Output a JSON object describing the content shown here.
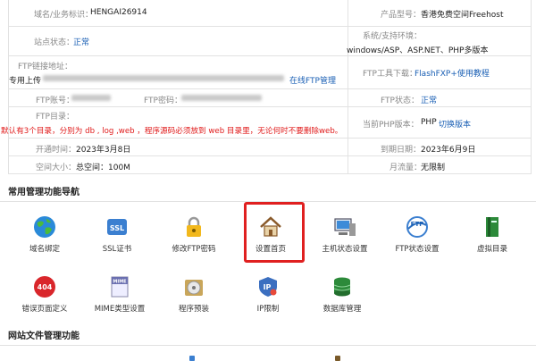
{
  "account": {
    "domain_label": "域名/业务标识：",
    "domain_value": "HENGAI26914",
    "product_label": "产品型号：",
    "product_value": "香港免费空间Freehost",
    "site_status_label": "站点状态：",
    "site_status_value": "正常",
    "env_label": "系统/支持环境：",
    "env_value": "windows/ASP、ASP.NET、PHP多版本",
    "ftp_addr_label": "FTP链接地址：",
    "ftp_addr_prefix": "专用上传",
    "ftp_online_link": "在线FTP管理",
    "ftp_tool_label": "FTP工具下载：",
    "ftp_tool_link": "FlashFXP+使用教程",
    "ftp_account_label": "FTP账号：",
    "ftp_password_label": "FTP密码：",
    "ftp_status_label": "FTP状态：",
    "ftp_status_value": "正常",
    "ftp_dir_label": "FTP目录：",
    "ftp_dir_warning": "默认有3个目录，分别为 db , log ,web ，程序源码必须放到 web 目录里，无论何时不要删除web。",
    "php_label": "当前PHP版本：",
    "php_value": "PHP",
    "php_switch": "切换版本",
    "open_label": "开通时间：",
    "open_value": "2023年3月8日",
    "expire_label": "到期日期：",
    "expire_value": "2023年6月9日",
    "space_label": "空间大小：",
    "space_value": "总空间：100M",
    "traffic_label": "月流量：",
    "traffic_value": "无限制"
  },
  "sections": {
    "common": "常用管理功能导航",
    "files": "网站文件管理功能"
  },
  "nav": [
    {
      "label": "域名绑定",
      "icon": "globe-icon"
    },
    {
      "label": "SSL证书",
      "icon": "ssl-icon"
    },
    {
      "label": "修改FTP密码",
      "icon": "lock-icon"
    },
    {
      "label": "设置首页",
      "icon": "home-icon"
    },
    {
      "label": "主机状态设置",
      "icon": "computer-icon"
    },
    {
      "label": "FTP状态设置",
      "icon": "ftp-icon"
    },
    {
      "label": "虚拟目录",
      "icon": "book-icon"
    },
    {
      "label": "错误页面定义",
      "icon": "error-404-icon"
    },
    {
      "label": "MIME类型设置",
      "icon": "mime-icon"
    },
    {
      "label": "程序预装",
      "icon": "disc-icon"
    },
    {
      "label": "IP限制",
      "icon": "ip-icon"
    },
    {
      "label": "数据库管理",
      "icon": "database-icon"
    }
  ],
  "colors": {
    "accent": "#1a5fb4",
    "warning": "#e01a1a",
    "highlight": "#e02020"
  }
}
